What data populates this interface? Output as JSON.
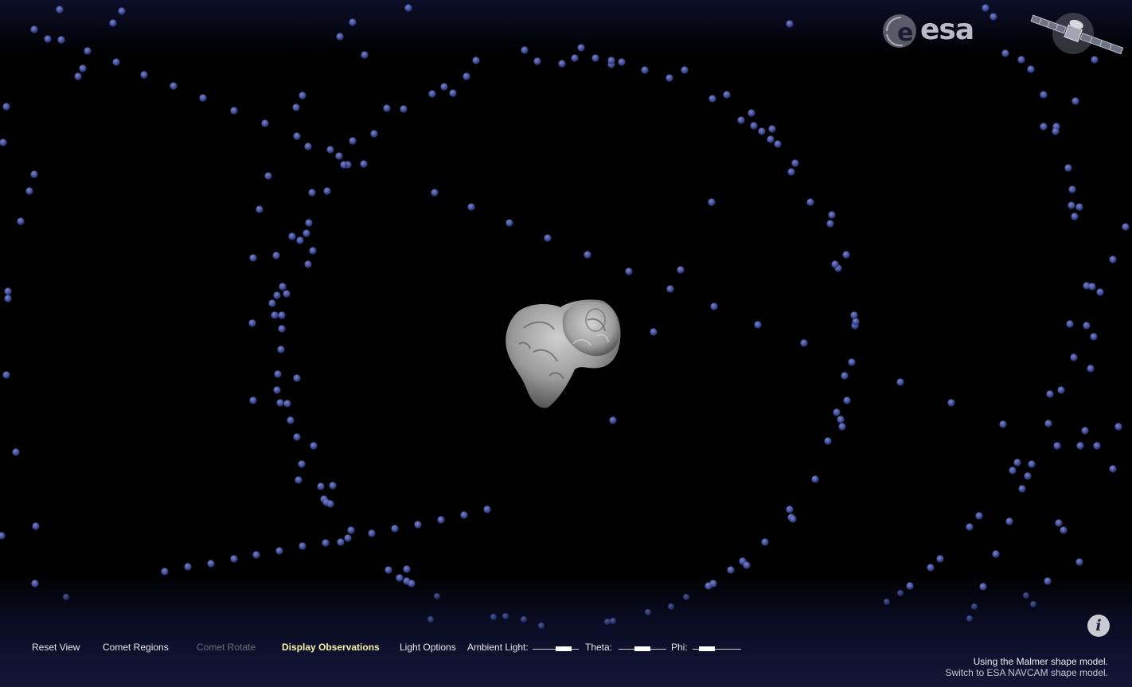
{
  "branding": {
    "agency_logo": "esa",
    "spacecraft_icon": "rosetta-spacecraft-icon"
  },
  "viewer": {
    "object_icon": "comet-67p-shape-icon",
    "observation_marker_color": "#4a5aa8"
  },
  "toolbar": {
    "reset_view": "Reset View",
    "comet_regions": "Comet Regions",
    "comet_rotate": "Comet Rotate",
    "display_observations": "Display Observations",
    "light_options": "Light Options"
  },
  "lighting": {
    "ambient_label": "Ambient Light:",
    "ambient_value": 0.75,
    "theta_label": "Theta:",
    "theta_value": 0.5,
    "phi_label": "Phi:",
    "phi_value": 0.2
  },
  "status": {
    "model_text": "Using the Malmer shape model.",
    "switch_text": "Switch to ESA NAVCAM shape model."
  },
  "colors": {
    "active_menu": "#f7f4a7",
    "disabled_menu": "#6d6e77",
    "menu_text": "#e7e7ea"
  }
}
